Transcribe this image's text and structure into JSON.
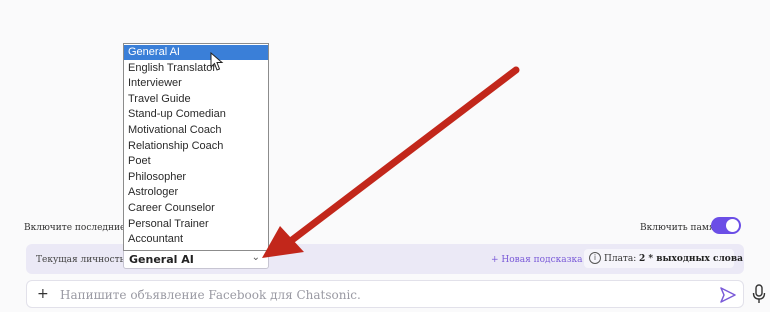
{
  "memory": {
    "hint": "Включите последние д",
    "toggle_label": "Включить память:",
    "enabled": true
  },
  "persona": {
    "label": "Текущая личность:",
    "selected": "General AI",
    "options": [
      "General AI",
      "English Translator",
      "Interviewer",
      "Travel Guide",
      "Stand-up Comedian",
      "Motivational Coach",
      "Relationship Coach",
      "Poet",
      "Philosopher",
      "Astrologer",
      "Career Counselor",
      "Personal Trainer",
      "Accountant"
    ]
  },
  "toolbar": {
    "new_prompt": "+ Новая подсказка",
    "fee_label": "Плата:",
    "fee_value": "2 * выходных слова"
  },
  "input": {
    "placeholder": "Напишите объявление Facebook для Chatsonic."
  },
  "colors": {
    "accent": "#6b4ee6",
    "selection": "#3a7fd8",
    "arrow": "#c2271b"
  },
  "icons": [
    "plus-icon",
    "info-icon",
    "send-icon",
    "mic-icon",
    "chevron-down-icon",
    "mouse-cursor-icon"
  ]
}
